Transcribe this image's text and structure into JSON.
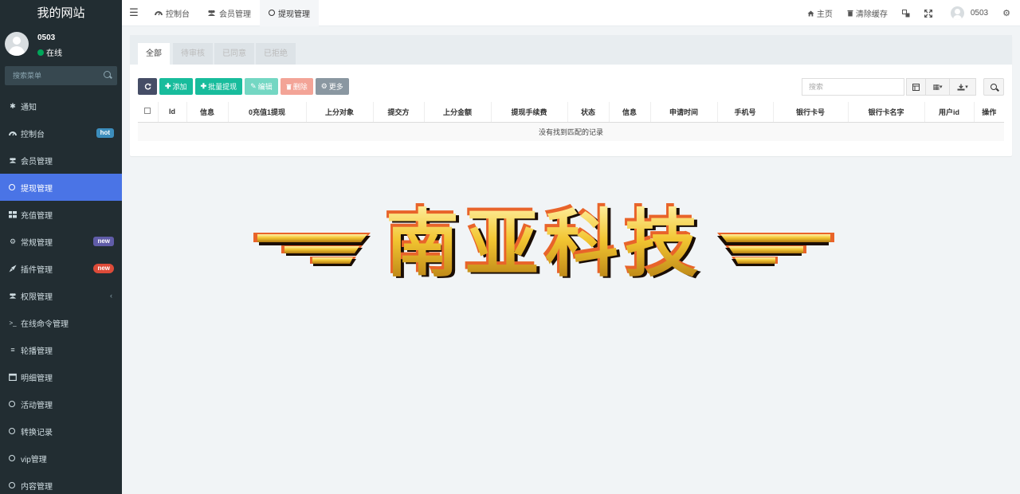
{
  "sidebar": {
    "site_title": "我的网站",
    "user": {
      "name": "0503",
      "status": "在线"
    },
    "search_placeholder": "搜索菜单",
    "items": [
      {
        "label": "通知",
        "icon": "asterisk-icon"
      },
      {
        "label": "控制台",
        "icon": "dashboard-icon",
        "badge": "hot"
      },
      {
        "label": "会员管理",
        "icon": "users-icon"
      },
      {
        "label": "提现管理",
        "icon": "circle-icon",
        "active": true
      },
      {
        "label": "充值管理",
        "icon": "grid-icon"
      },
      {
        "label": "常规管理",
        "icon": "cogs-icon",
        "badge": "new"
      },
      {
        "label": "插件管理",
        "icon": "rocket-icon",
        "badge": "new"
      },
      {
        "label": "权限管理",
        "icon": "users-icon"
      },
      {
        "label": "在线命令管理",
        "icon": "terminal-icon"
      },
      {
        "label": "轮播管理",
        "icon": "list-icon"
      },
      {
        "label": "明细管理",
        "icon": "calendar-icon"
      },
      {
        "label": "活动管理",
        "icon": "circle-icon"
      },
      {
        "label": "转换记录",
        "icon": "circle-icon"
      },
      {
        "label": "vip管理",
        "icon": "circle-icon"
      },
      {
        "label": "内容管理",
        "icon": "circle-icon"
      }
    ]
  },
  "topbar": {
    "tabs": [
      {
        "label": "控制台"
      },
      {
        "label": "会员管理"
      },
      {
        "label": "提现管理",
        "active": true
      }
    ],
    "home": "主页",
    "clear_cache": "清除缓存",
    "username": "0503"
  },
  "panel": {
    "tabs": [
      "全部",
      "待审核",
      "已同意",
      "已拒绝"
    ],
    "toolbar": {
      "add": "添加",
      "batch_withdraw": "批量提现",
      "edit": "编辑",
      "delete": "删除",
      "more": "更多"
    },
    "search_placeholder": "搜索",
    "columns": [
      "Id",
      "信息",
      "0充值1提现",
      "上分对象",
      "提交方",
      "上分金额",
      "提现手续费",
      "状态",
      "信息",
      "申请时间",
      "手机号",
      "银行卡号",
      "银行卡名字",
      "用户id",
      "操作"
    ],
    "empty_text": "没有找到匹配的记录"
  },
  "banner": {
    "text": "南亚科技",
    "colors": {
      "gold": "#f2c531",
      "shadow": "#1a0d05",
      "outline": "#e8642a"
    }
  }
}
